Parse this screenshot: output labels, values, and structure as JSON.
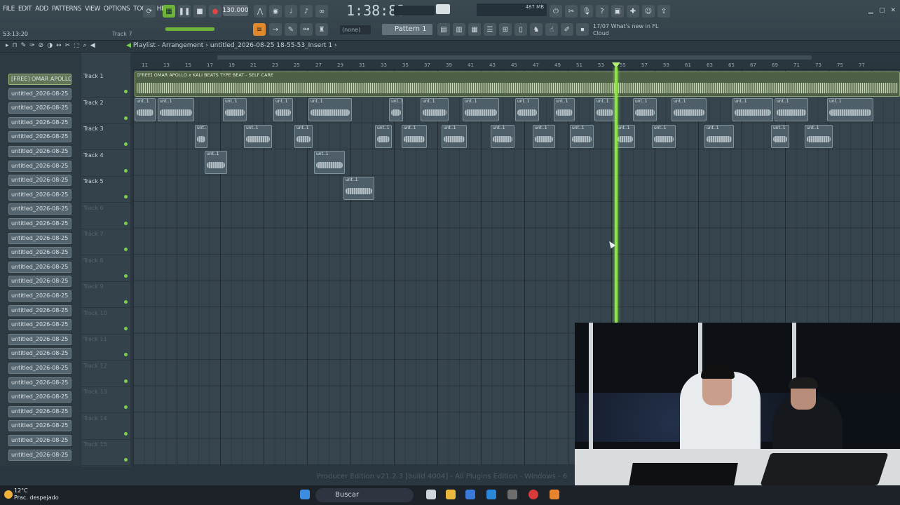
{
  "menu": [
    "FILE",
    "EDIT",
    "ADD",
    "PATTERNS",
    "VIEW",
    "OPTIONS",
    "TOOLS",
    "HELP"
  ],
  "transport": {
    "time": "1:38:83",
    "bpm": "130.000",
    "coord": "53:13:20",
    "track_hint": "Track 7",
    "pattern": "Pattern 1",
    "none_select": "(none)",
    "memory": "487 MB"
  },
  "news": {
    "line1": "What's new in FL",
    "line2": "Cloud",
    "label": "17/07"
  },
  "playlist": {
    "title": "Playlist - Arrangement",
    "file": "untitled_2026-08-25 18-55-53_Insert 1"
  },
  "ruler": [
    "11",
    "13",
    "15",
    "17",
    "19",
    "21",
    "23",
    "25",
    "27",
    "29",
    "31",
    "33",
    "35",
    "37",
    "39",
    "41",
    "43",
    "45",
    "47",
    "49",
    "51",
    "53",
    "55",
    "57",
    "59",
    "61",
    "63",
    "65",
    "67",
    "69",
    "71",
    "73",
    "75",
    "77"
  ],
  "tracks": [
    "Track 1",
    "Track 2",
    "Track 3",
    "Track 4",
    "Track 5",
    "Track 6",
    "Track 7",
    "Track 8",
    "Track 9",
    "Track 10",
    "Track 11",
    "Track 12",
    "Track 13",
    "Track 14",
    "Track 15"
  ],
  "patterns": [
    "[FREE] OMAR APOLLO...",
    "untitled_2026-08-25 18-",
    "untitled_2026-08-25 18-",
    "untitled_2026-08-25 18-",
    "untitled_2026-08-25 18-",
    "untitled_2026-08-25 18-",
    "untitled_2026-08-25 18-",
    "untitled_2026-08-25 18-",
    "untitled_2026-08-25 18-",
    "untitled_2026-08-25 18-",
    "untitled_2026-08-25 18-",
    "untitled_2026-08-25 18-",
    "untitled_2026-08-25 18-",
    "untitled_2026-08-25 18-",
    "untitled_2026-08-25 18-",
    "untitled_2026-08-25 18-",
    "untitled_2026-08-25 18-",
    "untitled_2026-08-25 18-",
    "untitled_2026-08-25 18-",
    "untitled_2026-08-25 18-",
    "untitled_2026-08-25 18-",
    "untitled_2026-08-25 18-",
    "untitled_2026-08-25 18-",
    "untitled_2026-08-25 18-",
    "untitled_2026-08-25 18-",
    "untitled_2026-08-25 18-",
    "untitled_2026-08-25 18-"
  ],
  "main_clip": "[FREE] OMAR APOLLO x KALI BEATS TYPE BEAT - SELF CARE",
  "clip_label_short": "unt..1",
  "footnote": "Producer Edition v21.2.3 [build 4004] - All Plugins Edition - Windows - 6",
  "taskbar": {
    "weather_temp": "12°C",
    "weather_desc": "Prac. despejado",
    "search": "Buscar"
  },
  "colors": {
    "playhead": "#8ee34a",
    "clip_main": "#4e5f47",
    "clip": "#4f5f69"
  }
}
